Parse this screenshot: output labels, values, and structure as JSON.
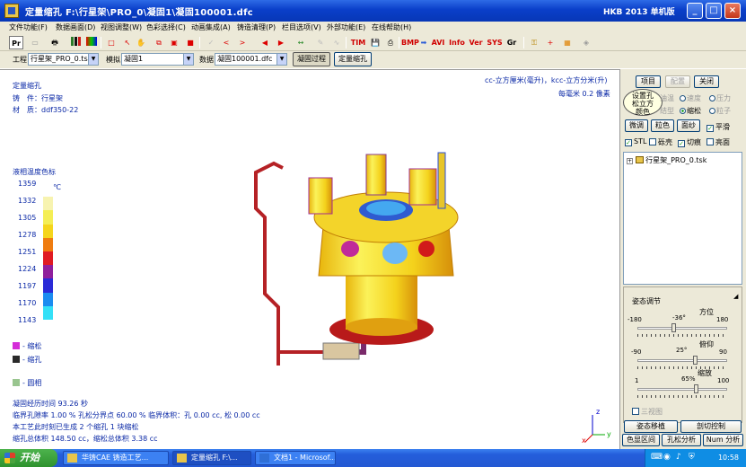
{
  "window": {
    "title": "定量缩孔  F:\\行星架\\PRO_0\\凝固1\\凝固100001.dfc",
    "right_label": "HKB  2013  单机版",
    "minimize_label": "_",
    "maximize_label": "□",
    "close_label": "×"
  },
  "menu": [
    "文件功能(F)",
    "数据画面(D)",
    "视图调整(W)",
    "色彩选择(C)",
    "动画集成(A)",
    "铸造清理(P)",
    "栏目选项(V)",
    "外部功能(E)",
    "在线帮助(H)"
  ],
  "toolbar": {
    "pr": "Pr",
    "tim": "TIM",
    "bmp": "BMP",
    "avi": "AVI",
    "info": "Info",
    "ver": "Ver",
    "sys": "SYS",
    "gr": "Gr"
  },
  "selectors": {
    "project_label": "工程",
    "project_value": "行星架_PRO_0.tsk",
    "sim_label": "模拟",
    "sim_value": "凝固1",
    "data_label": "数据",
    "data_value": "凝固100001.dfc",
    "solidify_button": "凝固过程",
    "shrink_button": "定量缩孔"
  },
  "viewport": {
    "heading": "定量缩孔",
    "part_label": "铸　件：行星架",
    "material_label": "材　质：ddf350-22",
    "units_line": "cc-立方厘米(毫升)，kcc-立方分米(升)",
    "scale_line": "每毫米 0.2 像素",
    "legend_title": "液相温度色标",
    "legend_unit": "℃",
    "legend_values": [
      "1359",
      "1332",
      "1305",
      "1278",
      "1251",
      "1224",
      "1197",
      "1170",
      "1143"
    ],
    "legend_colors": [
      "#ffffff",
      "#f7f3b0",
      "#f4ee55",
      "#f5d51c",
      "#ef7c10",
      "#e01b22",
      "#8f1f9c",
      "#2a2ad7",
      "#1b8cf0",
      "#34e0f7"
    ],
    "marks": [
      {
        "label": "- 缩松",
        "color": "#d42dd8"
      },
      {
        "label": "- 缩孔",
        "color": "#2a2a2a"
      },
      {
        "label": "- 圆相",
        "color": "#99c58f"
      }
    ],
    "stats": [
      "凝固经历时间 93.26 秒",
      "临界孔隙率 1.00 %     孔松分界点 60.00 %     临界体积：孔 0.00 cc, 松 0.00 cc",
      "本工艺此时刻已生成 2 个缩孔 1 块缩松",
      "缩孔总体积 148.50 cc，缩松总体积 3.38 cc"
    ],
    "axis": {
      "z": "z",
      "y": "y",
      "x": "x"
    }
  },
  "rpanel": {
    "project_btn": "项目",
    "config_btn": "配置",
    "close_btn": "关闭",
    "tooltip": "设置孔\n松立方\n颜色",
    "row1": [
      "油温",
      "速度",
      "压力"
    ],
    "row2": [
      "结型",
      "缩松",
      "粒子"
    ],
    "smooth_btn": "微调",
    "color_btn": "粒色",
    "surface_btn": "面纱",
    "flat_label": "平滑",
    "stl_label": "STL",
    "shell_label": "砾壳",
    "cut_label": "切痕",
    "bright_label": "亮面",
    "tree_root": "行星架_PRO_0.tsk",
    "pose_title": "姿态调节",
    "orient_label": "方位",
    "orient_min": "-180",
    "orient_max": "180",
    "orient_value": "-36°",
    "pitch_label": "俯仰",
    "pitch_min": "-90",
    "pitch_max": "90",
    "pitch_value": "25°",
    "zoom_label": "缩放",
    "zoom_min": "1",
    "zoom_max": "100",
    "zoom_value": "65%",
    "three_view": "三视图",
    "pose_btn": "姿态移植",
    "cut_ctrl_btn": "剖切控制",
    "range_btn": "色显区间",
    "hole_btn": "孔松分析",
    "num_btn": "Num 分析"
  },
  "taskbar": {
    "start": "开始",
    "tasks": [
      "华铸CAE 铸造工艺...",
      "定量缩孔  F:\\...",
      "文档1 - Microsof..."
    ],
    "clock": "10:58"
  }
}
